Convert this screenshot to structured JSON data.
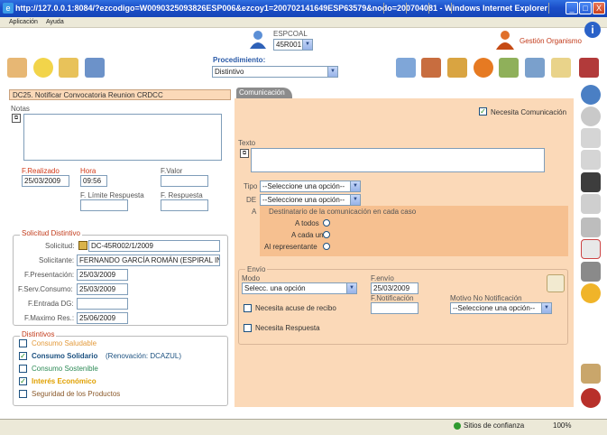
{
  "window": {
    "title": "http://127.0.0.1:8084/?ezcodigo=W0090325093826ESP006&ezcoy1=200702141649ESP63579&nodo=200704081 - Windows Internet Explorer",
    "min": "_",
    "max": "□",
    "close": "X"
  },
  "menu": {
    "items": [
      "Aplicación",
      "Ayuda"
    ]
  },
  "header": {
    "user_label": "ESPCOAL",
    "user_select": "45R001",
    "org_label": "Gestión Organismo",
    "procedure_label": "Procedimiento:",
    "procedure_value": "Distintivo"
  },
  "left": {
    "title": "DC25. Notificar Convocatoria Reunion CRDCC",
    "notas_label": "Notas",
    "f_realizado_label": "F.Realizado",
    "f_realizado_value": "25/03/2009",
    "hora_label": "Hora",
    "hora_value": "09:56",
    "f_valor_label": "F.Valor",
    "f_limite_label": "F. Límite Respuesta",
    "f_respuesta_label": "F. Respuesta",
    "solicitud_box": {
      "legend": "Solicitud Distintivo",
      "solicitud_label": "Solicitud:",
      "solicitud_value": "DC-45R002/1/2009",
      "solicitante_label": "Solicitante:",
      "solicitante_value": "FERNANDO GARCÍA ROMÁN (ESPIRAL INF",
      "f_presentacion_label": "F.Presentación:",
      "f_presentacion_value": "25/03/2009",
      "f_serv_label": "F.Serv.Consumo:",
      "f_serv_value": "25/03/2009",
      "f_entrada_label": "F.Entrada DG:",
      "f_entrada_value": "",
      "f_maximo_label": "F.Maximo Res.:",
      "f_maximo_value": "25/06/2009"
    },
    "distintivos": {
      "legend": "Distintivos",
      "items": [
        {
          "label": "Consumo Saludable",
          "checked": false,
          "extra": "",
          "color": "#e39a3b"
        },
        {
          "label": "Consumo Solidario",
          "checked": true,
          "extra": "(Renovación: DCAZUL)",
          "color": "#1c5180"
        },
        {
          "label": "Consumo Sostenible",
          "checked": false,
          "extra": "",
          "color": "#2e8b57"
        },
        {
          "label": "Interés Económico",
          "checked": true,
          "extra": "",
          "color": "#e0a000"
        },
        {
          "label": "Seguridad de los Productos",
          "checked": false,
          "extra": "",
          "color": "#8b5a2b"
        }
      ]
    }
  },
  "right": {
    "tab": "Comunicación",
    "necesita_comunicacion": "Necesita Comunicación",
    "texto_label": "Texto",
    "tipo_label": "Tipo",
    "tipo_value": "--Seleccione una opción--",
    "de_label": "DE",
    "de_value": "--Seleccione una opción--",
    "a_label": "A",
    "dest_title": "Destinatario de la comunicación en cada caso",
    "dest_options": [
      "A todos",
      "A cada uno",
      "Al representante"
    ],
    "envio": {
      "legend": "Envío",
      "modo_label": "Modo",
      "modo_value": "Selecc. una opción",
      "f_envio_label": "F.envío",
      "f_envio_value": "25/03/2009",
      "acuse_label": "Necesita acuse de recibo",
      "f_notif_label": "F.Notificación",
      "motivo_label": "Motivo No Notificación",
      "motivo_value": "--Seleccione una opción--",
      "respuesta_label": "Necesita Respuesta"
    }
  },
  "status": {
    "zone": "Sitios de confianza",
    "zoom": "100%"
  }
}
